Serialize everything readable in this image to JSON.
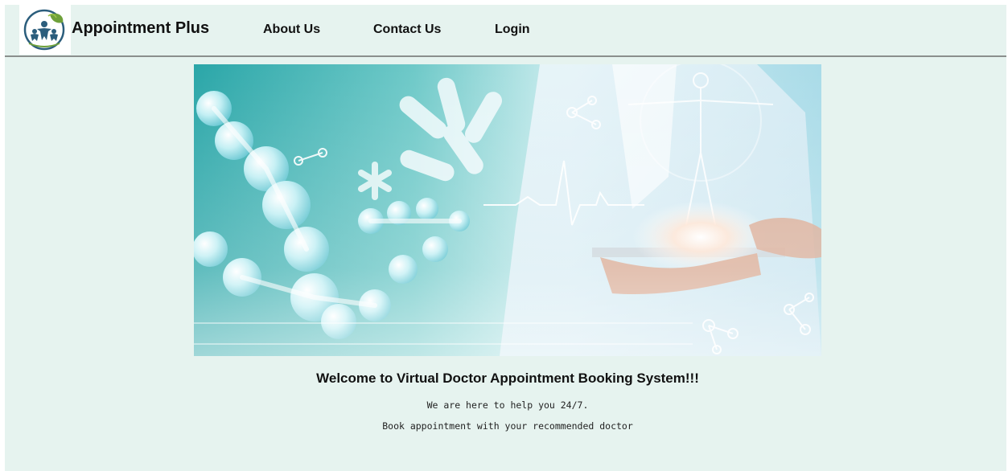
{
  "header": {
    "brand": "Appointment Plus",
    "logo": "family-leaf-logo",
    "nav": [
      {
        "label": "About Us"
      },
      {
        "label": "Contact Us"
      },
      {
        "label": "Login"
      }
    ]
  },
  "hero": {
    "image": "medical-dna-doctor-tablet-banner"
  },
  "main": {
    "welcome": "Welcome to Virtual Doctor Appointment Booking System!!!",
    "tagline": "We are here to help you 24/7.",
    "subtitle": "Book appointment with your recommended doctor"
  },
  "colors": {
    "page_background": "#e6f3ef",
    "header_divider": "#8a8f8d",
    "text": "#111111"
  }
}
